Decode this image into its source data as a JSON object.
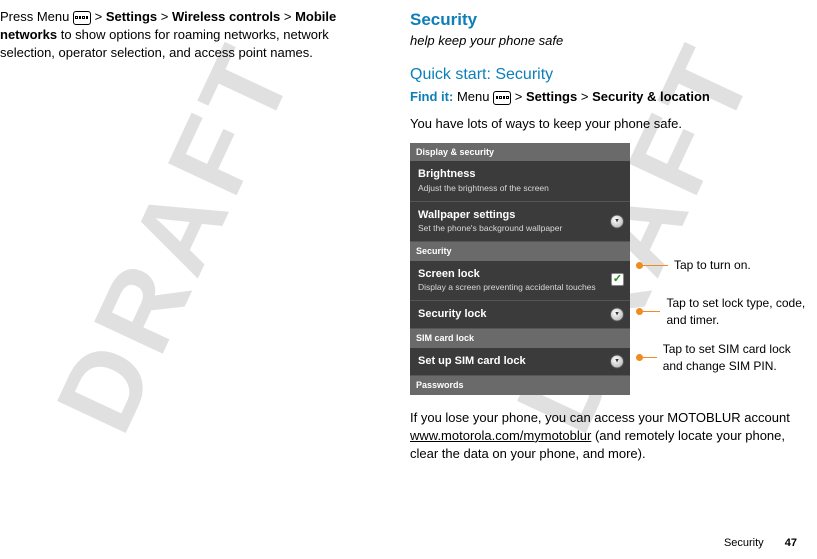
{
  "left": {
    "p1_a": "Press Menu ",
    "p1_b": " > ",
    "p1_settings": "Settings",
    "p1_c": " > ",
    "p1_wireless": "Wireless controls",
    "p1_d": " > ",
    "p1_mobile": "Mobile networks",
    "p1_e": " to show options for roaming networks, network selection, operator selection, and access point names."
  },
  "right": {
    "h_security": "Security",
    "h_sub": "help keep your phone safe",
    "h_quick": "Quick start: Security",
    "findit": "Find it:",
    "f_menu": " Menu ",
    "f_gt1": " > ",
    "f_settings": "Settings",
    "f_gt2": " > ",
    "f_secloc": "Security & location",
    "p_intro": "You have lots of ways to keep your phone safe.",
    "phone": {
      "hdr1": "Display & security",
      "item1_t": "Brightness",
      "item1_d": "Adjust the brightness of the screen",
      "item2_t": "Wallpaper settings",
      "item2_d": "Set the phone's background wallpaper",
      "hdr2": "Security",
      "item3_t": "Screen lock",
      "item3_d": "Display a screen preventing accidental touches",
      "item4_t": "Security lock",
      "hdr3": "SIM card lock",
      "item5_t": "Set up SIM card lock",
      "hdr4": "Passwords"
    },
    "callout1": "Tap to turn on.",
    "callout2": "Tap to set lock type, code, and timer.",
    "callout3": "Tap to set SIM card lock and change SIM PIN.",
    "p_after_a": "If you lose your phone, you can access your MOTOBLUR account ",
    "p_after_link": "www.motorola.com/mymotoblur",
    "p_after_b": " (and remotely locate your phone, clear the data on your phone, and more)."
  },
  "footer": {
    "section": "Security",
    "page": "47"
  },
  "watermark": "DRAFT"
}
